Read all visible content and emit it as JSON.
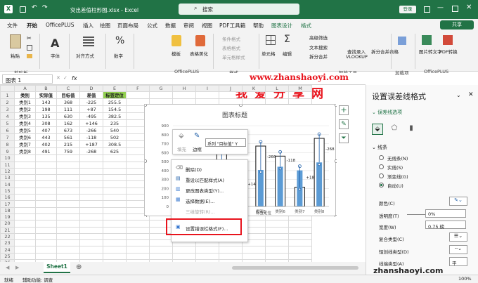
{
  "title": {
    "filename": "突出差值柱形图.xlsx",
    "app": "Excel",
    "search": "搜索",
    "login": "登录"
  },
  "menu": {
    "items": [
      "文件",
      "开始",
      "OfficePLUS",
      "插入",
      "绘图",
      "页面布局",
      "公式",
      "数据",
      "审阅",
      "视图",
      "PDF工具箱",
      "帮助",
      "图表设计",
      "格式"
    ],
    "share": "共享"
  },
  "ribbon": {
    "clipboard": "剪贴板",
    "paste": "粘贴",
    "font": "字体",
    "align": "对齐方式",
    "number": "数字",
    "template": "模板",
    "beautify": "表格美化",
    "officeplus": "OfficePLUS",
    "cond_format": "条件格式",
    "table_format": "表格格式",
    "cell_style": "单元格样式",
    "style": "样式",
    "cells": "单元格",
    "edit": "编辑",
    "adv_filter": "高级筛选",
    "text_search": "文本搜索",
    "split_merge": "拆分合并",
    "lookup": "查找录入",
    "vlookup": "VLOOKUP",
    "split_table": "拆分合并表格",
    "smart_tools": "智能工具",
    "addins": "加载项",
    "pic_to_text": "图片转文字",
    "pdf_convert": "PDF转换",
    "officeplus2": "OfficePLUS",
    "smart_select": "智能选择"
  },
  "watermark": {
    "line1": "我爱分享网",
    "line2": "www.zhanshaoyi.com"
  },
  "formula": {
    "namebox": "图表 1",
    "fx": "fx"
  },
  "sheet": {
    "cols": [
      "A",
      "B",
      "C",
      "D",
      "E",
      "F",
      "G",
      "H",
      "I",
      "J",
      "K",
      "L",
      "M"
    ],
    "headers": [
      "类别",
      "实际值",
      "目标值",
      "差值",
      "标签定位"
    ],
    "rows": [
      [
        "类别1",
        "143",
        "368",
        "-225",
        "255.5"
      ],
      [
        "类别2",
        "198",
        "111",
        "+87",
        "154.5"
      ],
      [
        "类别3",
        "135",
        "630",
        "-495",
        "382.5"
      ],
      [
        "类别4",
        "308",
        "162",
        "+146",
        "235"
      ],
      [
        "类别5",
        "407",
        "673",
        "-266",
        "540"
      ],
      [
        "类别6",
        "443",
        "561",
        "-118",
        "502"
      ],
      [
        "类别7",
        "402",
        "215",
        "+187",
        "308.5"
      ],
      [
        "类别8",
        "491",
        "759",
        "-268",
        "625"
      ]
    ],
    "tab": "Sheet1"
  },
  "chart": {
    "title": "图表标题",
    "series_dropdown": "系列 \"目标值\" Y",
    "yticks": [
      "900",
      "800",
      "700",
      "600",
      "500",
      "400",
      "300",
      "200",
      "100",
      "0"
    ],
    "xlabels_visible": [
      "类别1",
      "类别5",
      "类别6",
      "类别7",
      "类别8"
    ],
    "diff_labels": {
      "类别4": "+146",
      "类别5": "-266",
      "类别6": "-118",
      "类别7": "+187",
      "类别8": "-268"
    },
    "legend": [
      "标值",
      "标签定位"
    ]
  },
  "chart_data": {
    "type": "bar",
    "categories": [
      "类别1",
      "类别2",
      "类别3",
      "类别4",
      "类别5",
      "类别6",
      "类别7",
      "类别8"
    ],
    "series": [
      {
        "name": "实际值",
        "values": [
          143,
          198,
          135,
          308,
          407,
          443,
          402,
          491
        ]
      },
      {
        "name": "目标值",
        "values": [
          368,
          111,
          630,
          162,
          673,
          561,
          215,
          759
        ]
      }
    ],
    "title": "图表标题",
    "ylim": [
      0,
      900
    ]
  },
  "mini": {
    "fill": "填充",
    "border": "边框"
  },
  "context": {
    "items": [
      "删除(D)",
      "重设以匹配样式(A)",
      "更改图表类型(Y)...",
      "选择数据(E)...",
      "三维旋转(R)...",
      "设置错误栏格式(F)..."
    ]
  },
  "panel": {
    "title": "设置误差线格式",
    "tab": "误差线选项",
    "section": "线条",
    "options": [
      "无线条(N)",
      "实线(S)",
      "渐变线(G)",
      "自动(U)"
    ],
    "color": "颜色(C)",
    "transparency": "透明度(T)",
    "transparency_val": "0%",
    "width": "宽度(W)",
    "width_val": "0.75 磅",
    "compound": "复合类型(C)",
    "dash": "短划线类型(D)",
    "cap": "线端类型(A)",
    "cap_val": "平"
  },
  "status": {
    "ready": "就绪",
    "accessibility": "辅助功能: 调查",
    "zoom": "100%",
    "wm": "zhanshaoyi.com"
  }
}
